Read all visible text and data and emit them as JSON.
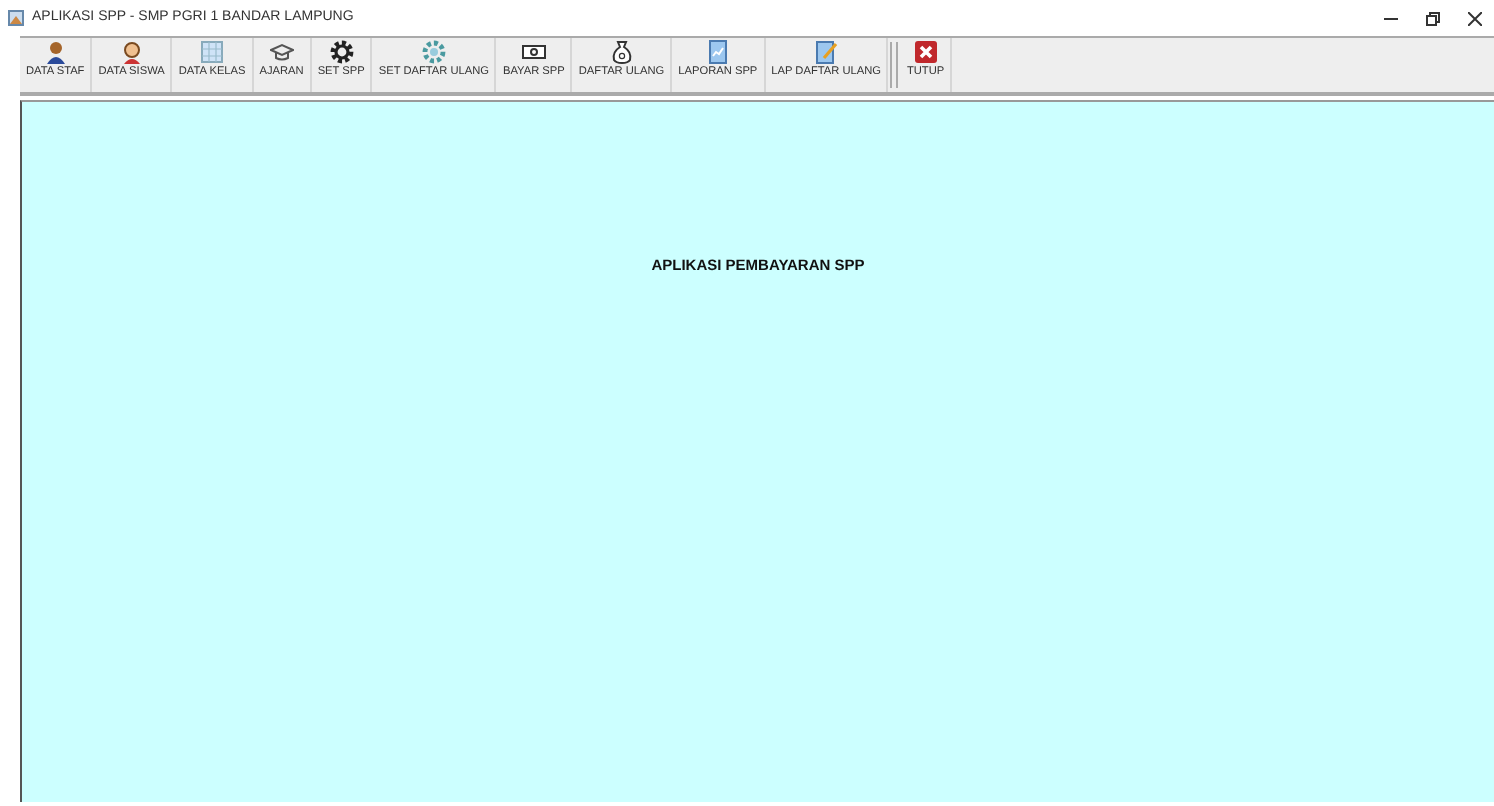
{
  "window": {
    "title": "APLIKASI SPP - SMP PGRI 1 BANDAR LAMPUNG"
  },
  "toolbar": [
    {
      "label": "DATA STAF",
      "separator_before": false
    },
    {
      "label": "DATA SISWA",
      "separator_before": false
    },
    {
      "label": "DATA KELAS",
      "separator_before": false
    },
    {
      "label": "AJARAN",
      "separator_before": false
    },
    {
      "label": "SET SPP",
      "separator_before": false
    },
    {
      "label": "SET DAFTAR ULANG",
      "separator_before": false
    },
    {
      "label": "BAYAR SPP",
      "separator_before": false
    },
    {
      "label": "DAFTAR ULANG",
      "separator_before": false
    },
    {
      "label": "LAPORAN SPP",
      "separator_before": false
    },
    {
      "label": "LAP DAFTAR ULANG",
      "separator_before": false
    },
    {
      "label": "TUTUP",
      "separator_before": true
    }
  ],
  "main": {
    "heading": "APLIKASI PEMBAYARAN SPP"
  }
}
